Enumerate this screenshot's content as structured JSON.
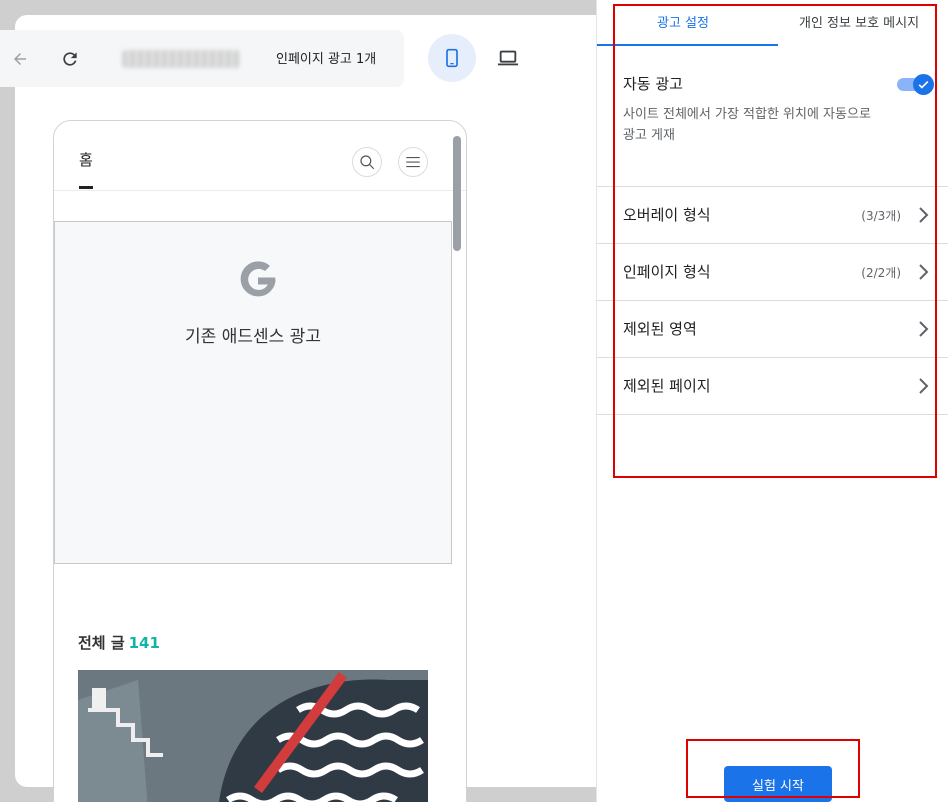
{
  "toolbar": {
    "back_icon": "arrow-left-icon",
    "refresh_icon": "refresh-icon",
    "inpage_count": "인페이지 광고 1개",
    "mobile_icon": "smartphone-icon",
    "desktop_icon": "laptop-icon"
  },
  "preview": {
    "home_tab": "홈",
    "search_icon": "search-icon",
    "menu_icon": "menu-icon",
    "ad_label": "기존 애드센스 광고",
    "posts_label": "전체 글",
    "posts_count": "141"
  },
  "panel": {
    "tabs": [
      {
        "label": "광고 설정",
        "active": true
      },
      {
        "label": "개인 정보 보호 메시지",
        "active": false
      }
    ],
    "auto_ads": {
      "title": "자동 광고",
      "description": "사이트 전체에서 가장 적합한 위치에 자동으로 광고 게재",
      "enabled": true
    },
    "rows": [
      {
        "label": "오버레이 형식",
        "count": "(3/3개)"
      },
      {
        "label": "인페이지 형식",
        "count": "(2/2개)"
      },
      {
        "label": "제외된 영역",
        "count": ""
      },
      {
        "label": "제외된 페이지",
        "count": ""
      }
    ],
    "start_button": "실험 시작"
  },
  "colors": {
    "accent": "#1a73e8",
    "highlight": "#e00000",
    "count_teal": "#12b5a5"
  }
}
